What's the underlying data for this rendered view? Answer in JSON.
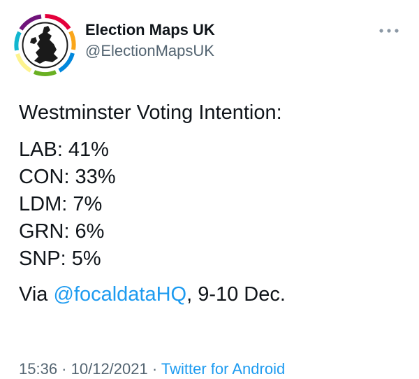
{
  "author": {
    "display_name": "Election Maps UK",
    "handle": "@ElectionMapsUK",
    "avatar_icon": "election-maps-uk-logo"
  },
  "menu": {
    "more_icon": "more-dots-icon"
  },
  "tweet": {
    "heading": "Westminster Voting Intention:",
    "results": [
      {
        "text": "LAB: 41%"
      },
      {
        "text": "CON: 33%"
      },
      {
        "text": "LDM: 7%"
      },
      {
        "text": "GRN: 6%"
      },
      {
        "text": "SNP: 5%"
      }
    ],
    "via_prefix": "Via ",
    "mention": "@focaldataHQ",
    "via_suffix": ", 9-10 Dec."
  },
  "meta": {
    "time": "15:36",
    "separator": " · ",
    "date": "10/12/2021",
    "source": "Twitter for Android"
  },
  "colors": {
    "text": "#0f1419",
    "secondary": "#536471",
    "link": "#1d9bf0"
  }
}
